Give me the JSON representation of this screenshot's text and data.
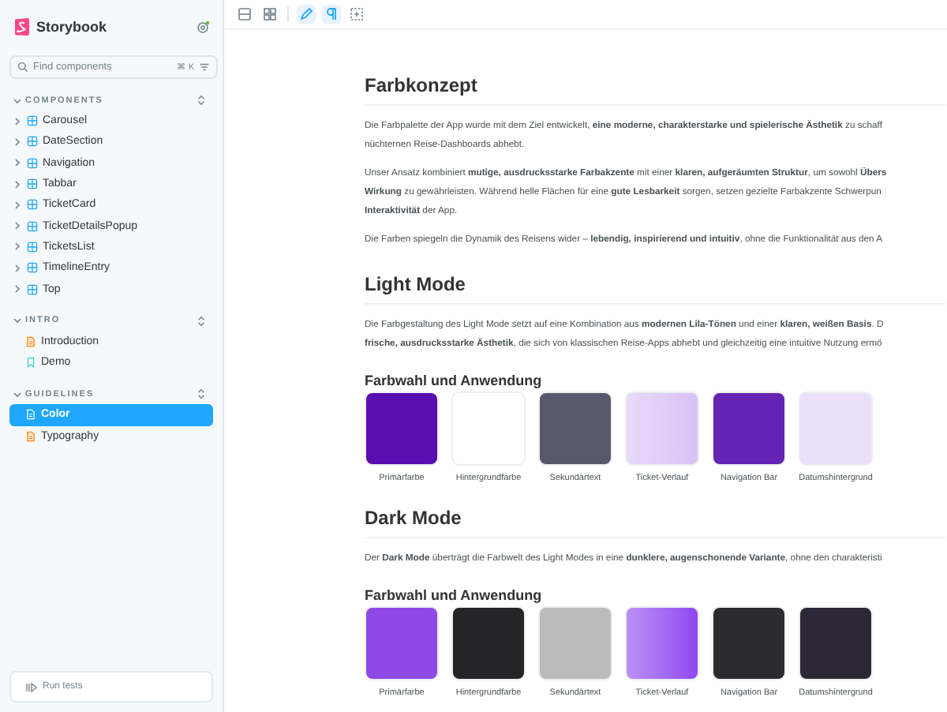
{
  "sidebar": {
    "brand": "Storybook",
    "search": {
      "placeholder": "Find components",
      "shortcut": "⌘ K"
    },
    "sections": [
      {
        "title": "COMPONENTS",
        "expanded": true,
        "items": [
          {
            "label": "Carousel",
            "kind": "component",
            "expanded": false,
            "selected": false
          },
          {
            "label": "DateSection",
            "kind": "component",
            "expanded": false,
            "selected": false
          },
          {
            "label": "Navigation",
            "kind": "component",
            "expanded": false,
            "selected": false
          },
          {
            "label": "Tabbar",
            "kind": "component",
            "expanded": false,
            "selected": false
          },
          {
            "label": "TicketCard",
            "kind": "component",
            "expanded": false,
            "selected": false
          },
          {
            "label": "TicketDetailsPopup",
            "kind": "component",
            "expanded": false,
            "selected": false
          },
          {
            "label": "TicketsList",
            "kind": "component",
            "expanded": false,
            "selected": false
          },
          {
            "label": "TimelineEntry",
            "kind": "component",
            "expanded": false,
            "selected": false
          },
          {
            "label": "Top",
            "kind": "component",
            "expanded": false,
            "selected": false
          }
        ]
      },
      {
        "title": "INTRO",
        "expanded": true,
        "items": [
          {
            "label": "Introduction",
            "kind": "doc",
            "selected": false
          },
          {
            "label": "Demo",
            "kind": "story",
            "selected": false
          }
        ]
      },
      {
        "title": "GUIDELINES",
        "expanded": true,
        "items": [
          {
            "label": "Color",
            "kind": "doc",
            "selected": true
          },
          {
            "label": "Typography",
            "kind": "doc",
            "selected": false
          }
        ]
      }
    ],
    "run_tests": "Run tests"
  },
  "toolbar": [
    {
      "kind": "single",
      "selected": false
    },
    {
      "kind": "grid",
      "selected": false
    },
    {
      "kind": "pen",
      "selected": true
    },
    {
      "kind": "pilcrow",
      "selected": true
    },
    {
      "kind": "outline",
      "selected": false
    }
  ],
  "content": {
    "blocks": [
      {
        "kind": "h1",
        "text": "Farbkonzept"
      },
      {
        "kind": "p",
        "lines": [
          "Die Farbpalette der App wurde mit dem Ziel entwickelt, **eine moderne, charakterstarke und spielerische Ästhetik** zu schaff",
          "nüchternen Reise-Dashboards abhebt."
        ]
      },
      {
        "kind": "p",
        "lines": [
          "Unser Ansatz kombiniert **mutige, ausdrucksstarke Farbakzente** mit einer **klaren, aufgeräumten Struktur**, um sowohl **Übers**",
          "**Wirkung** zu gewährleisten. Während helle Flächen für eine **gute Lesbarkeit** sorgen, setzen gezielte Farbakzente Schwerpun",
          "**Interaktivität** der App."
        ]
      },
      {
        "kind": "p",
        "lines": [
          "Die Farben spiegeln die Dynamik des Reisens wider – **lebendig, inspirierend und intuitiv**, ohne die Funktionalität aus den A"
        ]
      },
      {
        "kind": "h1",
        "text": "Light Mode"
      },
      {
        "kind": "p",
        "lines": [
          "Die Farbgestaltung des Light Mode setzt auf eine Kombination aus **modernen Lila-Tönen** und einer **klaren, weißen Basis**. D",
          "**frische, ausdrucksstarke Ästhetik**, die sich von klassischen Reise-Apps abhebt und gleichzeitig eine intuitive Nutzung ermö"
        ]
      },
      {
        "kind": "h2",
        "text": "Farbwahl und Anwendung"
      },
      {
        "kind": "swatches",
        "items": [
          {
            "label": "Primärfarbe",
            "kind": "solid",
            "color": "#5a0db0"
          },
          {
            "label": "Hintergrundfarbe",
            "kind": "solid",
            "color": "#ffffff"
          },
          {
            "label": "Sekundärtext",
            "kind": "solid",
            "color": "#555a6b"
          },
          {
            "label": "Ticket-Verlauf",
            "kind": "gradient",
            "color": "#d9c1f8"
          },
          {
            "label": "Navigation Bar",
            "kind": "solid",
            "color": "#6423b2"
          },
          {
            "label": "Datumshintergrund",
            "kind": "solid",
            "color": "#ecdffc"
          }
        ]
      },
      {
        "kind": "h1",
        "text": "Dark Mode"
      },
      {
        "kind": "p",
        "lines": [
          "Der **Dark Mode** überträgt die Farbwelt des Light Modes in eine **dunklere, augenschonende Variante**, ohne den charakteristi"
        ]
      },
      {
        "kind": "h2",
        "text": "Farbwahl und Anwendung"
      },
      {
        "kind": "swatches",
        "items": [
          {
            "label": "Primärfarbe",
            "kind": "solid",
            "color": "#8f4ae6"
          },
          {
            "label": "Hintergrundfarbe",
            "kind": "solid",
            "color": "#252527"
          },
          {
            "label": "Sekundärtext",
            "kind": "solid",
            "color": "#bbbbbb"
          },
          {
            "label": "Ticket-Verlauf",
            "kind": "gradient",
            "color": "#9045f0"
          },
          {
            "label": "Navigation Bar",
            "kind": "solid",
            "color": "#2c2b30"
          },
          {
            "label": "Datumshintergrund",
            "kind": "solid",
            "color": "#2d2836"
          }
        ]
      }
    ]
  }
}
